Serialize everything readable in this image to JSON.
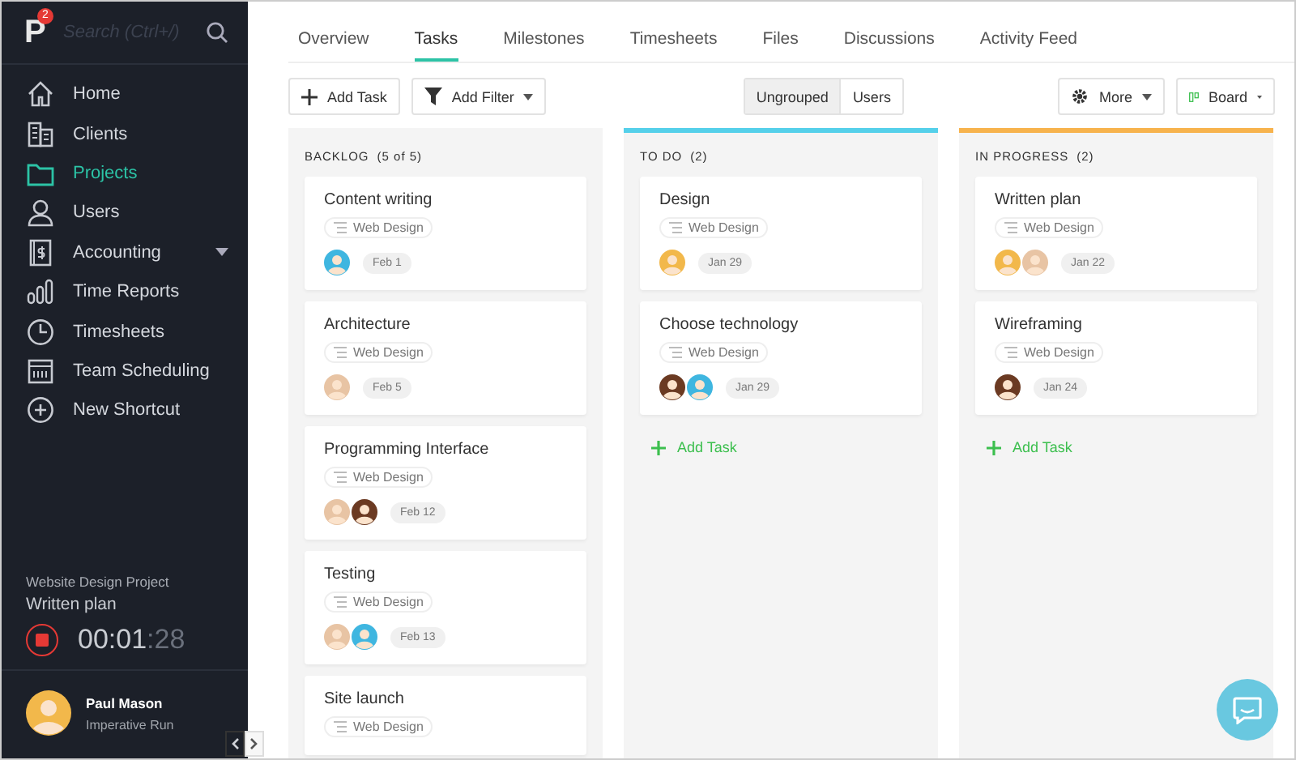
{
  "sidebar": {
    "logo": "P",
    "badge": "2",
    "search": {
      "placeholder": "Search (Ctrl+/)"
    },
    "items": [
      {
        "label": "Home",
        "selected": false
      },
      {
        "label": "Clients",
        "selected": false
      },
      {
        "label": "Projects",
        "selected": true
      },
      {
        "label": "Users",
        "selected": false
      },
      {
        "label": "Accounting",
        "selected": false,
        "has_submenu": true
      },
      {
        "label": "Time Reports",
        "selected": false
      },
      {
        "label": "Timesheets",
        "selected": false
      },
      {
        "label": "Team Scheduling",
        "selected": false
      },
      {
        "label": "New Shortcut",
        "selected": false
      }
    ],
    "timer": {
      "project": "Website Design Project",
      "task": "Written plan",
      "time_main": "00:01",
      "time_seconds": ":28",
      "running": true
    },
    "user": {
      "name": "Paul Mason",
      "company": "Imperative Run"
    }
  },
  "tabs": [
    {
      "label": "Overview",
      "selected": false
    },
    {
      "label": "Tasks",
      "selected": true
    },
    {
      "label": "Milestones",
      "selected": false
    },
    {
      "label": "Timesheets",
      "selected": false
    },
    {
      "label": "Files",
      "selected": false
    },
    {
      "label": "Discussions",
      "selected": false
    },
    {
      "label": "Activity Feed",
      "selected": false
    }
  ],
  "toolbar": {
    "add_task": "Add Task",
    "add_filter": "Add Filter",
    "grouping": [
      {
        "label": "Ungrouped",
        "selected": true
      },
      {
        "label": "Users",
        "selected": false
      }
    ],
    "more": "More",
    "view": "Board"
  },
  "columns": [
    {
      "title": "BACKLOG",
      "count": "(5 of 5)",
      "color": "#f4f4f4",
      "cards": [
        {
          "title": "Content writing",
          "tag": "Web Design",
          "date": "Feb 1",
          "assignees": [
            {
              "color": "#3fb6e0"
            }
          ]
        },
        {
          "title": "Architecture",
          "tag": "Web Design",
          "date": "Feb 5",
          "assignees": [
            {
              "color": "#e8c4a4"
            }
          ]
        },
        {
          "title": "Programming Interface",
          "tag": "Web Design",
          "date": "Feb 12",
          "assignees": [
            {
              "color": "#e8c4a4"
            },
            {
              "color": "#6b3a22"
            }
          ]
        },
        {
          "title": "Testing",
          "tag": "Web Design",
          "date": "Feb 13",
          "assignees": [
            {
              "color": "#e8c4a4"
            },
            {
              "color": "#3fb6e0"
            }
          ]
        },
        {
          "title": "Site launch",
          "tag": "Web Design"
        }
      ]
    },
    {
      "title": "TO DO",
      "count": "(2)",
      "color": "#55d0ea",
      "add_label": "Add Task",
      "cards": [
        {
          "title": "Design",
          "tag": "Web Design",
          "date": "Jan 29",
          "assignees": [
            {
              "color": "#f2b84b"
            }
          ]
        },
        {
          "title": "Choose technology",
          "tag": "Web Design",
          "date": "Jan 29",
          "assignees": [
            {
              "color": "#6b3a22"
            },
            {
              "color": "#3fb6e0"
            }
          ]
        }
      ]
    },
    {
      "title": "IN PROGRESS",
      "count": "(2)",
      "color": "#f7b34d",
      "add_label": "Add Task",
      "cards": [
        {
          "title": "Written plan",
          "tag": "Web Design",
          "date": "Jan 22",
          "assignees": [
            {
              "color": "#f2b84b"
            },
            {
              "color": "#e8c4a4"
            }
          ]
        },
        {
          "title": "Wireframing",
          "tag": "Web Design",
          "date": "Jan 24",
          "assignees": [
            {
              "color": "#6b3a22"
            }
          ]
        }
      ]
    }
  ]
}
